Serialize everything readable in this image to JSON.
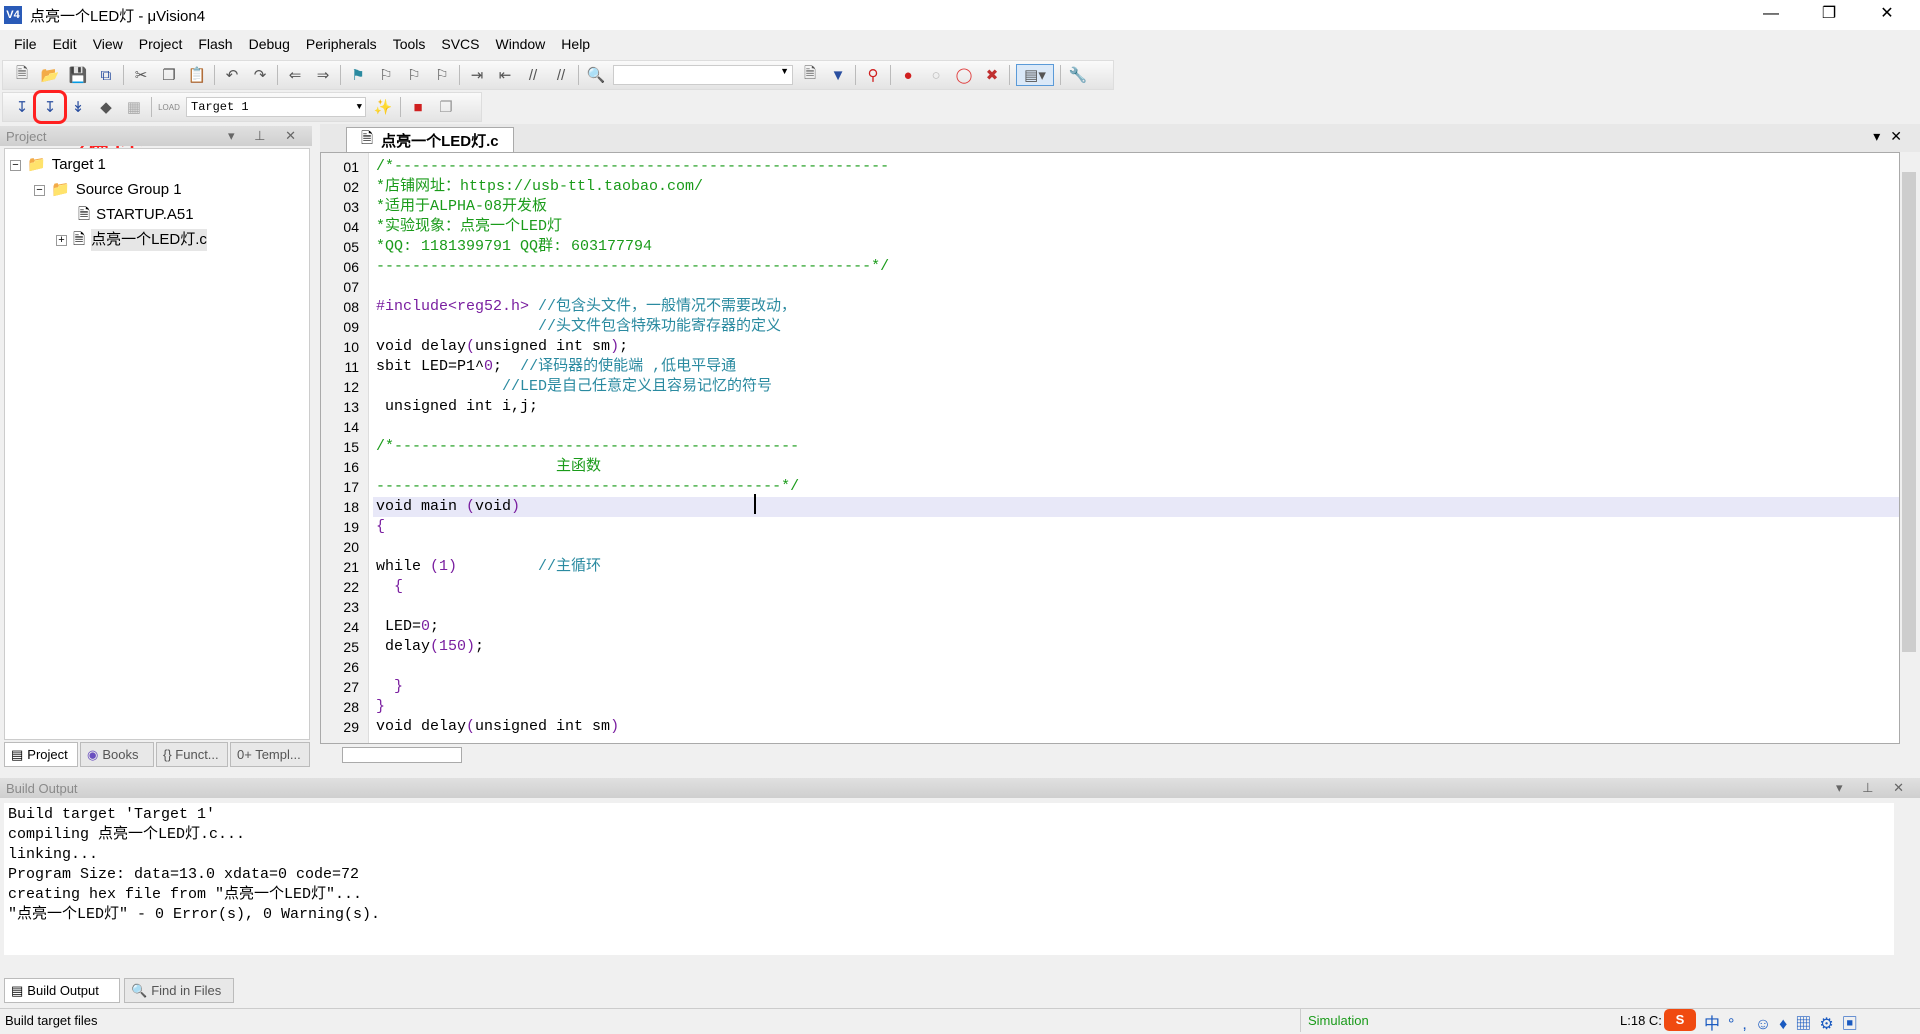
{
  "window": {
    "title": "点亮一个LED灯 - μVision4",
    "logo": "V4"
  },
  "menu": [
    "File",
    "Edit",
    "View",
    "Project",
    "Flash",
    "Debug",
    "Peripherals",
    "Tools",
    "SVCS",
    "Window",
    "Help"
  ],
  "toolbar2": {
    "target": "Target 1"
  },
  "annotation": {
    "label": "编译"
  },
  "project_panel": {
    "title": "Project",
    "tree": [
      {
        "label": "Target 1"
      },
      {
        "label": "Source Group 1"
      },
      {
        "label": "STARTUP.A51"
      },
      {
        "label": "点亮一个LED灯.c"
      }
    ],
    "tabs": [
      "Project",
      "Books",
      "{} Funct...",
      "0+ Templ..."
    ]
  },
  "editor": {
    "tab": "点亮一个LED灯.c",
    "cursor_line": 18,
    "lines": [
      {
        "n": "01",
        "parts": [
          [
            "cm",
            "/*-------------------------------------------------------"
          ]
        ]
      },
      {
        "n": "02",
        "parts": [
          [
            "cm",
            "*店铺网址：https://usb-ttl.taobao.com/"
          ]
        ]
      },
      {
        "n": "03",
        "parts": [
          [
            "cm",
            "*适用于ALPHA-08开发板"
          ]
        ]
      },
      {
        "n": "04",
        "parts": [
          [
            "cm",
            "*实验现象：点亮一个LED灯"
          ]
        ]
      },
      {
        "n": "05",
        "parts": [
          [
            "cm",
            "*QQ: 1181399791 QQ群: 603177794"
          ]
        ]
      },
      {
        "n": "06",
        "parts": [
          [
            "cm",
            "-------------------------------------------------------*/"
          ]
        ]
      },
      {
        "n": "07",
        "parts": []
      },
      {
        "n": "08",
        "parts": [
          [
            "num",
            "#include<reg52.h>"
          ],
          [
            "cmb",
            " //包含头文件，一般情况不需要改动，"
          ]
        ]
      },
      {
        "n": "09",
        "parts": [
          [
            "cmb",
            "                  //头文件包含特殊功能寄存器的定义"
          ]
        ]
      },
      {
        "n": "10",
        "parts": [
          [
            "kw",
            "void delay"
          ],
          [
            "num",
            "("
          ],
          [
            "kw",
            "unsigned int sm"
          ],
          [
            "num",
            ")"
          ],
          [
            "kw",
            ";"
          ]
        ]
      },
      {
        "n": "11",
        "parts": [
          [
            "kw",
            "sbit LED=P1^"
          ],
          [
            "num",
            "0"
          ],
          [
            "kw",
            ";"
          ],
          [
            "cmb",
            "  //译码器的使能端 ,低电平导通"
          ]
        ]
      },
      {
        "n": "12",
        "parts": [
          [
            "cmb",
            "              //LED是自己任意定义且容易记忆的符号"
          ]
        ]
      },
      {
        "n": "13",
        "parts": [
          [
            "kw",
            " unsigned int i,j;"
          ]
        ]
      },
      {
        "n": "14",
        "parts": []
      },
      {
        "n": "15",
        "parts": [
          [
            "cm",
            "/*---------------------------------------------"
          ]
        ]
      },
      {
        "n": "16",
        "parts": [
          [
            "cm",
            "                    主函数"
          ]
        ]
      },
      {
        "n": "17",
        "parts": [
          [
            "cm",
            "---------------------------------------------*/"
          ]
        ]
      },
      {
        "n": "18",
        "parts": [
          [
            "kw",
            "void main "
          ],
          [
            "num",
            "("
          ],
          [
            "kw",
            "void"
          ],
          [
            "num",
            ")"
          ]
        ]
      },
      {
        "n": "19",
        "parts": [
          [
            "num",
            "{"
          ]
        ]
      },
      {
        "n": "20",
        "parts": []
      },
      {
        "n": "21",
        "parts": [
          [
            "kw",
            "while "
          ],
          [
            "num",
            "(1)"
          ],
          [
            "cmb",
            "         //主循环"
          ]
        ]
      },
      {
        "n": "22",
        "parts": [
          [
            "num",
            "  {"
          ]
        ]
      },
      {
        "n": "23",
        "parts": []
      },
      {
        "n": "24",
        "parts": [
          [
            "kw",
            " LED="
          ],
          [
            "num",
            "0"
          ],
          [
            "kw",
            ";"
          ]
        ]
      },
      {
        "n": "25",
        "parts": [
          [
            "kw",
            " delay"
          ],
          [
            "num",
            "(150)"
          ],
          [
            "kw",
            ";"
          ]
        ]
      },
      {
        "n": "26",
        "parts": []
      },
      {
        "n": "27",
        "parts": [
          [
            "num",
            "  }"
          ]
        ]
      },
      {
        "n": "28",
        "parts": [
          [
            "num",
            "}"
          ]
        ]
      },
      {
        "n": "29",
        "parts": [
          [
            "kw",
            "void delay"
          ],
          [
            "num",
            "("
          ],
          [
            "kw",
            "unsigned int sm"
          ],
          [
            "num",
            ")"
          ]
        ]
      }
    ]
  },
  "build_output": {
    "title": "Build Output",
    "lines": [
      "Build target 'Target 1'",
      "compiling 点亮一个LED灯.c...",
      "linking...",
      "Program Size: data=13.0 xdata=0 code=72",
      "creating hex file from \"点亮一个LED灯\"...",
      "\"点亮一个LED灯\" - 0 Error(s), 0 Warning(s)."
    ],
    "tabs": [
      "Build Output",
      "Find in Files"
    ]
  },
  "status": {
    "left": "Build target files",
    "mode": "Simulation",
    "position": "L:18 C:"
  },
  "colors": {
    "comment": "#1a9b1a",
    "annotation": "#ff2020",
    "cursor_line": "#e8e8f8"
  }
}
